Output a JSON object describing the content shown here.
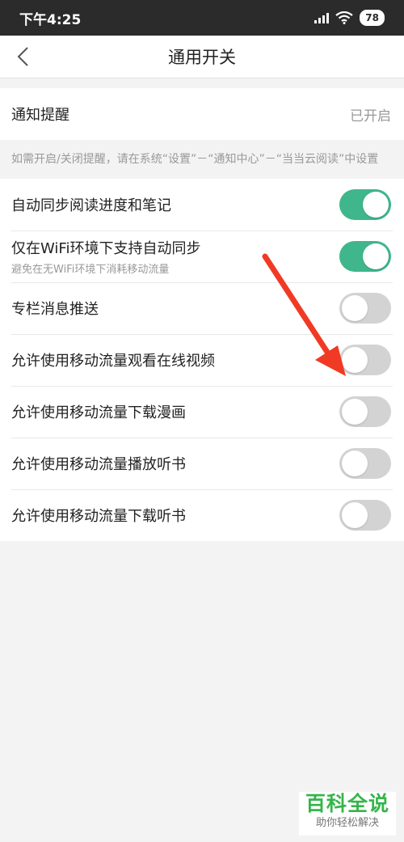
{
  "status": {
    "time": "下午4:25",
    "battery": "78"
  },
  "nav": {
    "title": "通用开关"
  },
  "notify": {
    "label": "通知提醒",
    "value": "已开启"
  },
  "hint": "如需开启/关闭提醒，请在系统“设置”－“通知中心”－“当当云阅读”中设置",
  "settings": [
    {
      "label": "自动同步阅读进度和笔记",
      "sub": "",
      "on": true
    },
    {
      "label": "仅在WiFi环境下支持自动同步",
      "sub": "避免在无WiFi环境下消耗移动流量",
      "on": true
    },
    {
      "label": "专栏消息推送",
      "sub": "",
      "on": false
    },
    {
      "label": "允许使用移动流量观看在线视频",
      "sub": "",
      "on": false
    },
    {
      "label": "允许使用移动流量下载漫画",
      "sub": "",
      "on": false
    },
    {
      "label": "允许使用移动流量播放听书",
      "sub": "",
      "on": false
    },
    {
      "label": "允许使用移动流量下载听书",
      "sub": "",
      "on": false
    }
  ],
  "colors": {
    "toggle_on": "#3fb68b",
    "toggle_off": "#d3d3d3",
    "arrow": "#f03a24"
  },
  "watermark": {
    "title": "百科全说",
    "subtitle": "助你轻松解决"
  }
}
